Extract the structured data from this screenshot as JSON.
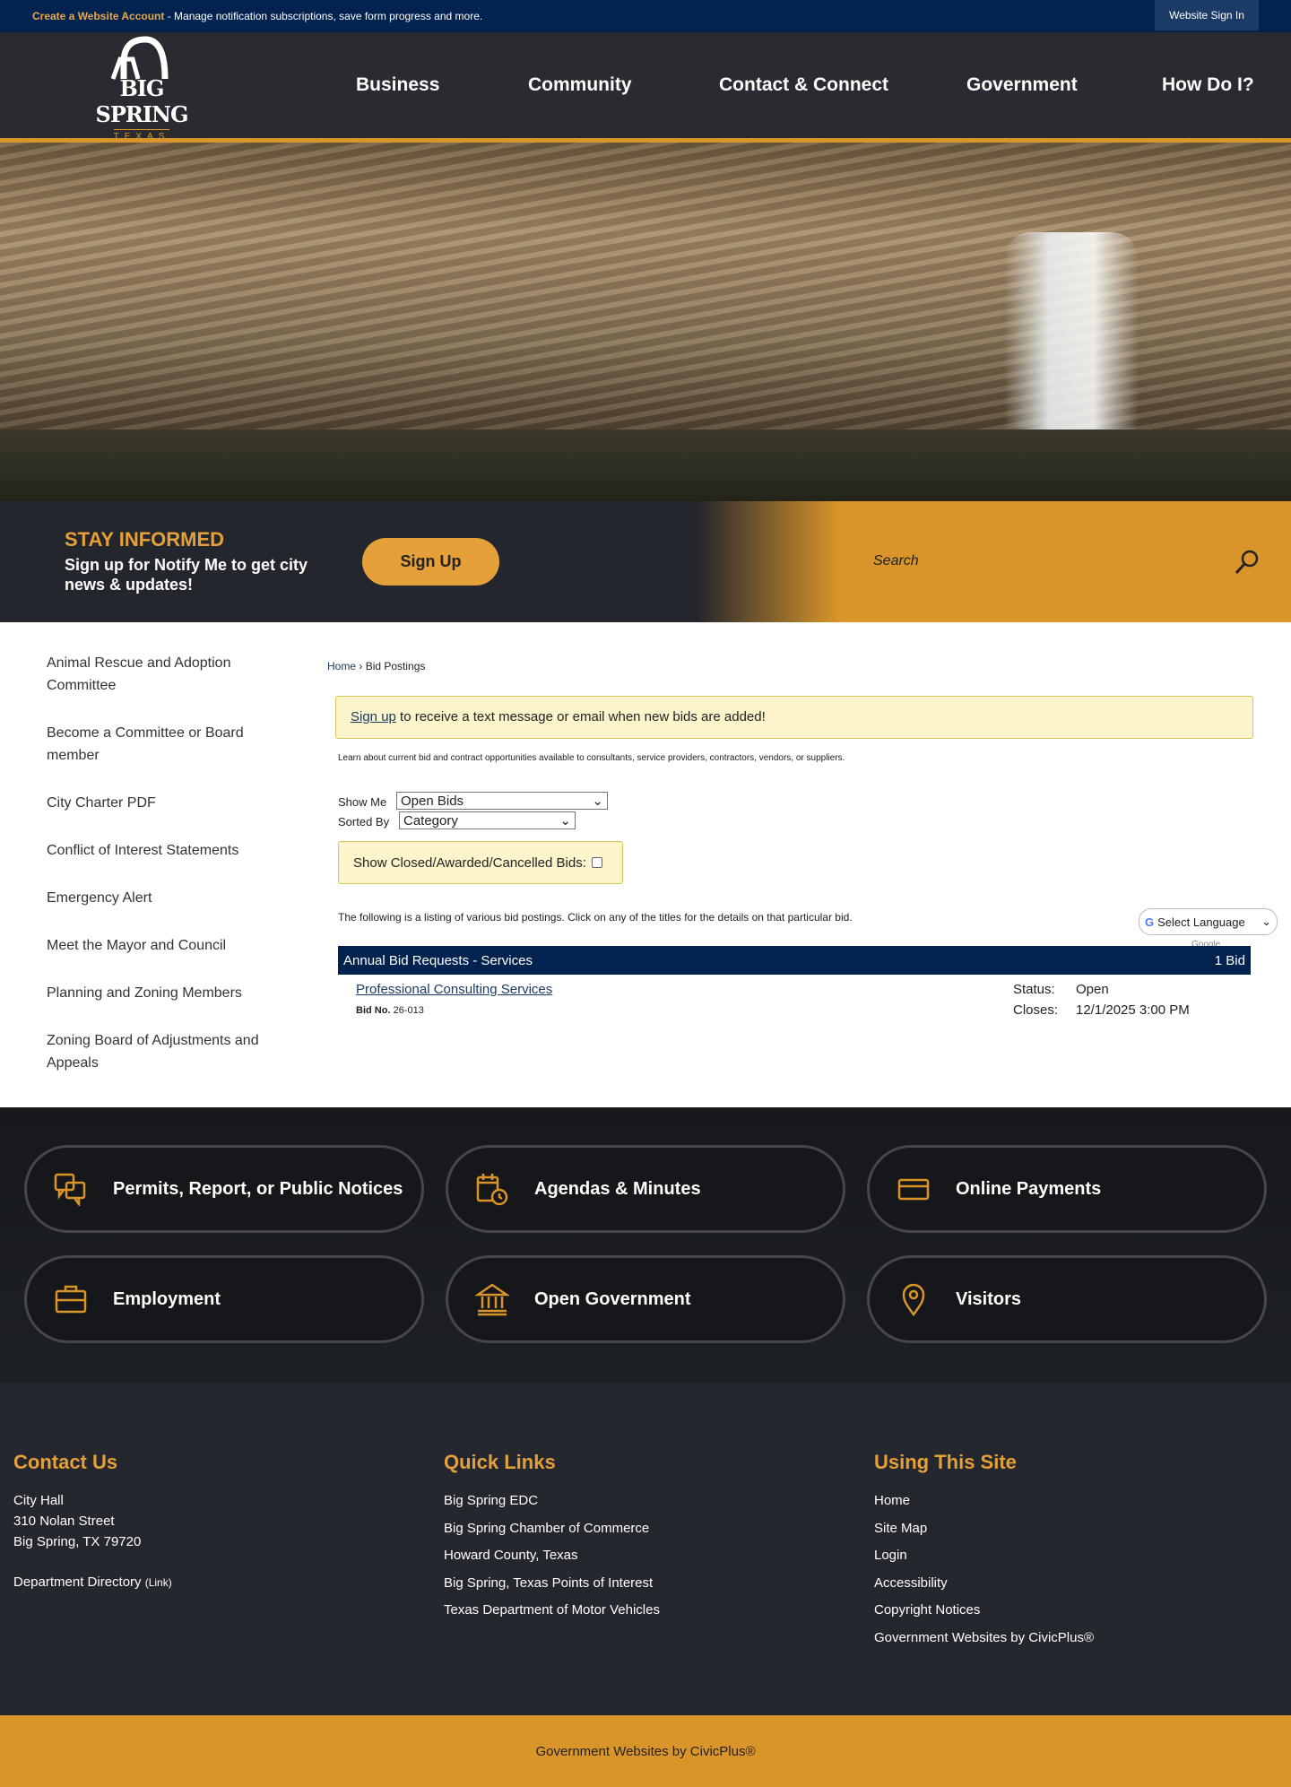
{
  "topbar": {
    "create_link": "Create a Website Account",
    "message": " - Manage notification subscriptions, save form progress and more.",
    "signin": "Website Sign In"
  },
  "logo": {
    "name": "BIG SPRING",
    "state": "TEXAS"
  },
  "nav": [
    "Business",
    "Community",
    "Contact & Connect",
    "Government",
    "How Do I?"
  ],
  "inform": {
    "title": "STAY INFORMED",
    "text_pre": "Sign up for ",
    "text_bold": "Notify Me",
    "text_post": " to get city news & updates!",
    "button": "Sign Up",
    "search_placeholder": "Search"
  },
  "sidebar": [
    "Animal Rescue and Adoption Committee",
    "Become a Committee or Board member",
    "City Charter PDF",
    "Conflict of Interest Statements",
    "Emergency Alert",
    "Meet the Mayor and Council",
    "Planning and Zoning Members",
    "Zoning Board of Adjustments and Appeals"
  ],
  "breadcrumb": {
    "home": "Home",
    "sep": " › ",
    "current": "Bid Postings"
  },
  "alert": {
    "link": "Sign up",
    "text": " to receive a text message or email when new bids are added!"
  },
  "learn": "Learn about current bid and contract opportunities available to consultants, service providers, contractors, vendors, or suppliers.",
  "filters": {
    "show_me_label": "Show Me",
    "show_me_value": "Open Bids",
    "sorted_by_label": "Sorted By",
    "sorted_by_value": "Category",
    "closed_label": "Show Closed/Awarded/Cancelled Bids:"
  },
  "listing_text": "The following is a listing of various bid postings. Click on any of the titles for the details on that particular bid.",
  "translate": {
    "select": "Select Language",
    "powered": "Google Translate"
  },
  "category": {
    "name": "Annual Bid Requests - Services",
    "count": "1 Bid"
  },
  "bid": {
    "title": "Professional Consulting Services",
    "no_label": "Bid No.",
    "no": "26-013",
    "status_label": "Status:",
    "status": "Open",
    "closes_label": "Closes:",
    "closes": "12/1/2025 3:00 PM"
  },
  "quick_links": [
    "Permits, Report, or Public Notices",
    "Agendas & Minutes",
    "Online Payments",
    "Employment",
    "Open Government",
    "Visitors"
  ],
  "footer": {
    "contact": {
      "title": "Contact Us",
      "lines": [
        "City Hall",
        "310 Nolan Street",
        "Big Spring, TX 79720"
      ],
      "dir": "Department Directory",
      "dir_link": "(Link)"
    },
    "quick": {
      "title": "Quick Links",
      "items": [
        "Big Spring EDC",
        "Big Spring Chamber of Commerce",
        "Howard County, Texas",
        "Big Spring, Texas Points of Interest",
        "Texas Department of Motor Vehicles"
      ]
    },
    "using": {
      "title": "Using This Site",
      "items": [
        "Home",
        "Site Map",
        "Login",
        "Accessibility",
        "Copyright Notices",
        "Government Websites by CivicPlus®"
      ]
    }
  },
  "bottom": "Government Websites by CivicPlus®",
  "colors": {
    "navy": "#022250",
    "gold": "#d9952a",
    "dark": "#2a2b30"
  }
}
